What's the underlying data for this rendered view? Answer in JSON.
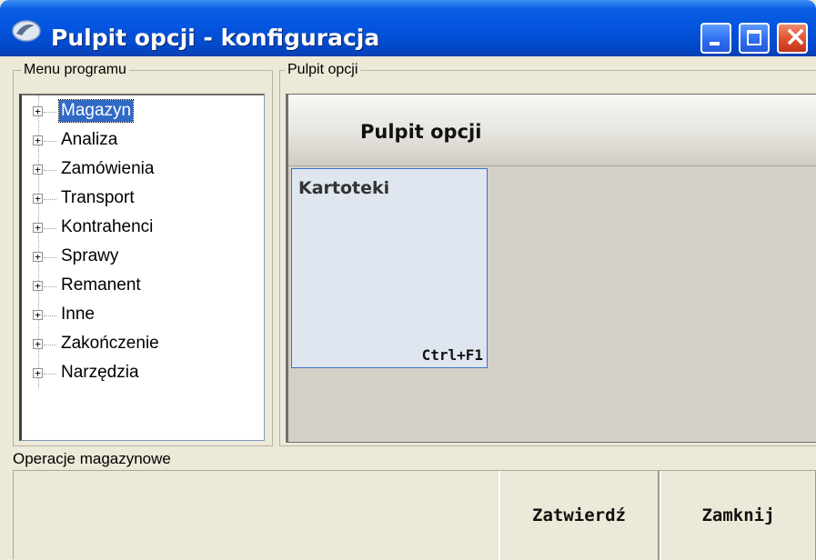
{
  "window": {
    "title": "Pulpit opcji - konfiguracja",
    "controls": {
      "minimize": "minimize",
      "maximize": "maximize",
      "close": "×"
    }
  },
  "menu_group": {
    "legend": "Menu programu",
    "items": [
      {
        "label": "Magazyn",
        "selected": true
      },
      {
        "label": "Analiza"
      },
      {
        "label": "Zamówienia"
      },
      {
        "label": "Transport"
      },
      {
        "label": "Kontrahenci"
      },
      {
        "label": "Sprawy"
      },
      {
        "label": "Remanent"
      },
      {
        "label": "Inne"
      },
      {
        "label": "Zakończenie"
      },
      {
        "label": "Narzędzia"
      }
    ],
    "expander_symbol": "+"
  },
  "pulpit_group": {
    "legend": "Pulpit opcji",
    "header_title": "Pulpit opcji",
    "tiles": [
      {
        "title": "Kartoteki",
        "shortcut": "Ctrl+F1"
      }
    ]
  },
  "status": {
    "text": "Operacje magazynowe"
  },
  "buttons": {
    "confirm": "Zatwierdź",
    "close": "Zamknij"
  },
  "colors": {
    "titlebar": "#0454df",
    "selection": "#316ac5",
    "tile_border": "#3b73c4",
    "close_button": "#e0502d"
  }
}
